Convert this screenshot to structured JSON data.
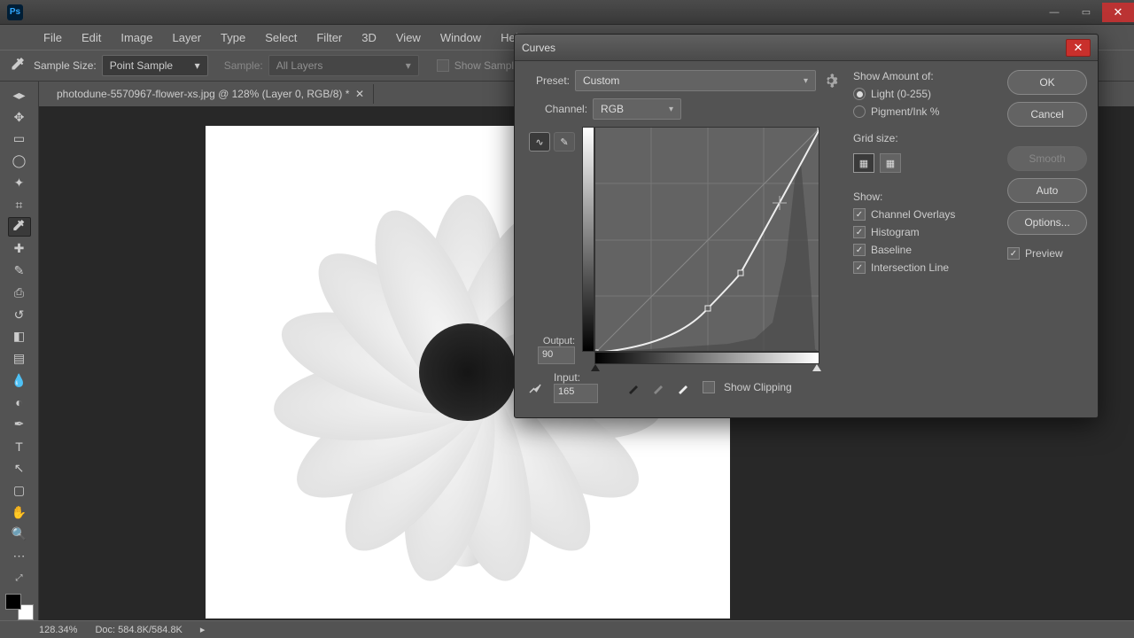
{
  "app": {
    "logo": "Ps"
  },
  "menu": [
    "File",
    "Edit",
    "Image",
    "Layer",
    "Type",
    "Select",
    "Filter",
    "3D",
    "View",
    "Window",
    "Help"
  ],
  "options": {
    "sample_size_label": "Sample Size:",
    "sample_size_value": "Point Sample",
    "sample_label": "Sample:",
    "sample_value": "All Layers",
    "show_sampling": "Show Sampling Ring"
  },
  "doc": {
    "tab_title": "photodune-5570967-flower-xs.jpg @ 128% (Layer 0, RGB/8) *"
  },
  "status": {
    "zoom": "128.34%",
    "doc_size": "Doc: 584.8K/584.8K"
  },
  "dialog": {
    "title": "Curves",
    "preset_label": "Preset:",
    "preset_value": "Custom",
    "channel_label": "Channel:",
    "channel_value": "RGB",
    "output_label": "Output:",
    "output_value": "90",
    "input_label": "Input:",
    "input_value": "165",
    "show_clipping": "Show Clipping",
    "show_amount_label": "Show Amount of:",
    "radio_light": "Light  (0-255)",
    "radio_pigment": "Pigment/Ink %",
    "grid_size_label": "Grid size:",
    "show_label": "Show:",
    "chk_overlays": "Channel Overlays",
    "chk_histogram": "Histogram",
    "chk_baseline": "Baseline",
    "chk_intersection": "Intersection Line",
    "preview_label": "Preview",
    "btn_ok": "OK",
    "btn_cancel": "Cancel",
    "btn_smooth": "Smooth",
    "btn_auto": "Auto",
    "btn_options": "Options..."
  },
  "chart_data": {
    "type": "line",
    "title": "Curves",
    "xlabel": "Input",
    "ylabel": "Output",
    "xlim": [
      0,
      255
    ],
    "ylim": [
      0,
      255
    ],
    "series": [
      {
        "name": "RGB curve",
        "x": [
          0,
          128,
          165,
          255
        ],
        "y": [
          0,
          50,
          90,
          255
        ]
      }
    ],
    "baseline": {
      "x": [
        0,
        255
      ],
      "y": [
        0,
        255
      ]
    },
    "histogram_hint": "right-heavy (image mostly highlights)"
  }
}
